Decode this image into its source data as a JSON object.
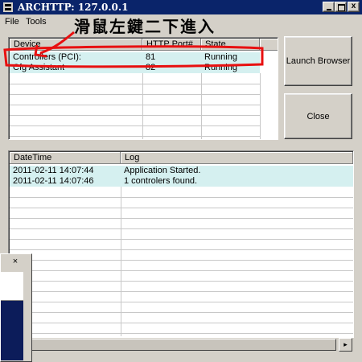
{
  "window": {
    "title": "ARCHTTP: 127.0.0.1"
  },
  "titlebar": {
    "close_glyph": "x"
  },
  "menu": [
    "File",
    "Tools"
  ],
  "devices": {
    "columns": [
      "Device",
      "HTTP Port#",
      "State"
    ],
    "rows": [
      {
        "device": "Controllers (PCI):",
        "port": "81",
        "state": "Running"
      },
      {
        "device": "Cfg Assistant",
        "port": "82",
        "state": "Running"
      }
    ]
  },
  "buttons": {
    "launch": "Launch Browser",
    "close": "Close"
  },
  "log": {
    "columns": [
      "DateTime",
      "Log"
    ],
    "rows": [
      {
        "datetime": "2011-02-11 14:07:44",
        "message": "Application Started."
      },
      {
        "datetime": "2011-02-11 14:07:46",
        "message": "1 controlers found."
      }
    ]
  },
  "scrollbar": {
    "right_arrow": "▸"
  },
  "overlay": {
    "close_glyph": "×"
  },
  "annotation": {
    "text": "滑鼠左鍵二下進入",
    "color": "#e81010"
  },
  "colors": {
    "titlebar": "#0a246a",
    "selection": "#d5f0f0",
    "face": "#d4d0c8"
  }
}
